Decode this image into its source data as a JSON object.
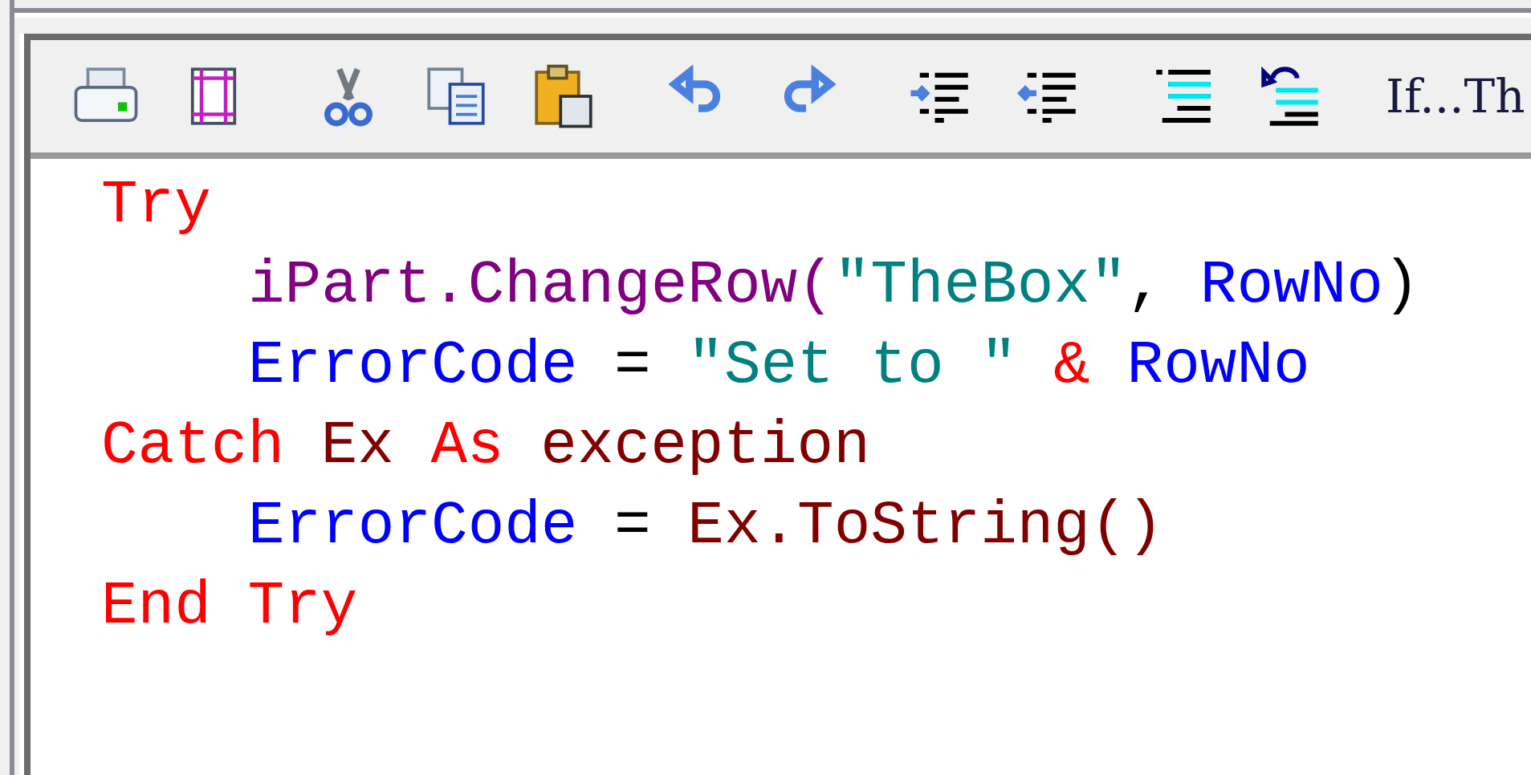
{
  "toolbar": {
    "groups": [
      {
        "buttons": [
          {
            "kind": "print"
          },
          {
            "kind": "page"
          }
        ]
      },
      {
        "buttons": [
          {
            "kind": "cut"
          },
          {
            "kind": "copy"
          },
          {
            "kind": "paste"
          }
        ]
      },
      {
        "buttons": [
          {
            "kind": "undo"
          },
          {
            "kind": "redo"
          }
        ]
      },
      {
        "buttons": [
          {
            "kind": "indent"
          },
          {
            "kind": "outdent"
          }
        ]
      },
      {
        "buttons": [
          {
            "kind": "lines"
          },
          {
            "kind": "wrap"
          }
        ]
      },
      {
        "buttons": [
          {
            "kind": "text",
            "label": "If...Th"
          }
        ]
      }
    ]
  },
  "code": {
    "lines": [
      {
        "tokens": [
          {
            "text": "Try",
            "kind": "keyword"
          }
        ],
        "children": [
          {
            "tokens": [
              {
                "text": "iPart.ChangeRow(",
                "kind": "method"
              },
              {
                "text": "\"TheBox\"",
                "kind": "string"
              },
              {
                "text": ", ",
                "kind": "operator"
              },
              {
                "text": "RowNo",
                "kind": "variable"
              },
              {
                "text": ")",
                "kind": "operator"
              }
            ]
          },
          {
            "tokens": [
              {
                "text": "ErrorCode",
                "kind": "variable"
              },
              {
                "text": " = ",
                "kind": "operator"
              },
              {
                "text": "\"Set to \"",
                "kind": "string"
              },
              {
                "text": " & ",
                "kind": "keyword"
              },
              {
                "text": "RowNo",
                "kind": "variable"
              }
            ]
          }
        ]
      },
      {
        "tokens": [
          {
            "text": "Catch ",
            "kind": "keyword"
          },
          {
            "text": "Ex ",
            "kind": "object"
          },
          {
            "text": "As ",
            "kind": "keyword"
          },
          {
            "text": "exception",
            "kind": "object"
          }
        ],
        "children": [
          {
            "tokens": [
              {
                "text": "ErrorCode",
                "kind": "variable"
              },
              {
                "text": " = ",
                "kind": "operator"
              },
              {
                "text": "Ex.ToString()",
                "kind": "object"
              }
            ]
          }
        ]
      },
      {
        "tokens": [
          {
            "text": "End Try",
            "kind": "keyword"
          }
        ]
      }
    ]
  }
}
